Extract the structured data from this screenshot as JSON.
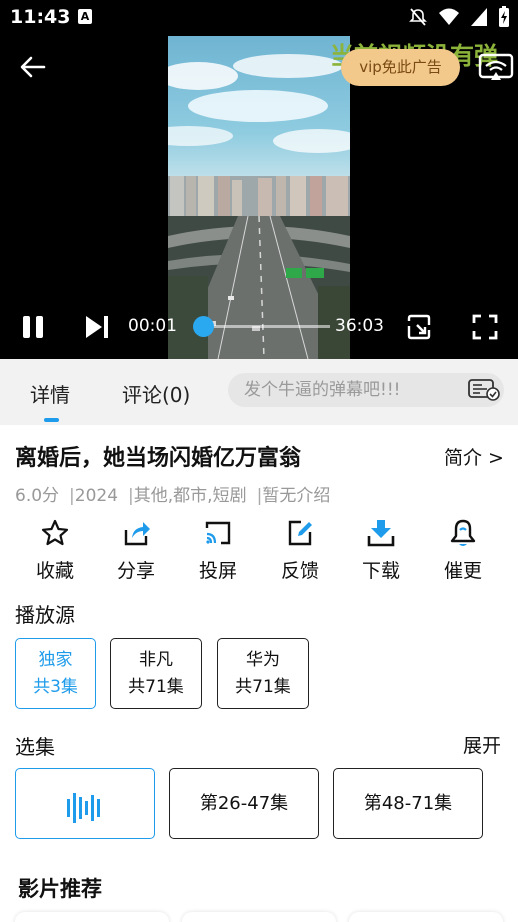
{
  "status_bar": {
    "time": "11:43",
    "badge": "A"
  },
  "player": {
    "marquee_text": "当前视频没有弹",
    "vip_button": "vip免此广告",
    "current_time": "00:01",
    "total_time": "36:03",
    "progress": 0.005
  },
  "tabs": [
    {
      "label": "详情"
    },
    {
      "label": "评论(0)"
    }
  ],
  "danmu": {
    "placeholder": "发个牛逼的弹幕吧!!!"
  },
  "drama": {
    "title": "离婚后，她当场闪婚亿万富翁",
    "intro_link": "简介 >",
    "score": "6.0分",
    "year": "2024",
    "genres": "其他,都市,短剧",
    "description": "暂无介绍"
  },
  "actions": [
    {
      "label": "收藏",
      "icon": "star-icon"
    },
    {
      "label": "分享",
      "icon": "share-icon"
    },
    {
      "label": "投屏",
      "icon": "cast-icon"
    },
    {
      "label": "反馈",
      "icon": "feedback-icon"
    },
    {
      "label": "下载",
      "icon": "download-icon"
    },
    {
      "label": "催更",
      "icon": "bell-icon"
    }
  ],
  "sources": {
    "label": "播放源",
    "items": [
      {
        "name": "独家",
        "count": "共3集",
        "selected": true
      },
      {
        "name": "非凡",
        "count": "共71集",
        "selected": false
      },
      {
        "name": "华为",
        "count": "共71集",
        "selected": false
      }
    ]
  },
  "episodes": {
    "label": "选集",
    "expand": "展开",
    "ranges": [
      {
        "label": "",
        "selected": true,
        "icon": "playing-bars-icon"
      },
      {
        "label": "第26-47集",
        "selected": false
      },
      {
        "label": "第48-71集",
        "selected": false
      }
    ]
  },
  "recommend": {
    "label": "影片推荐"
  },
  "colors": {
    "accent": "#1e9bea",
    "vip_bg": "#f2c88b",
    "marquee": "#8cb43a"
  }
}
